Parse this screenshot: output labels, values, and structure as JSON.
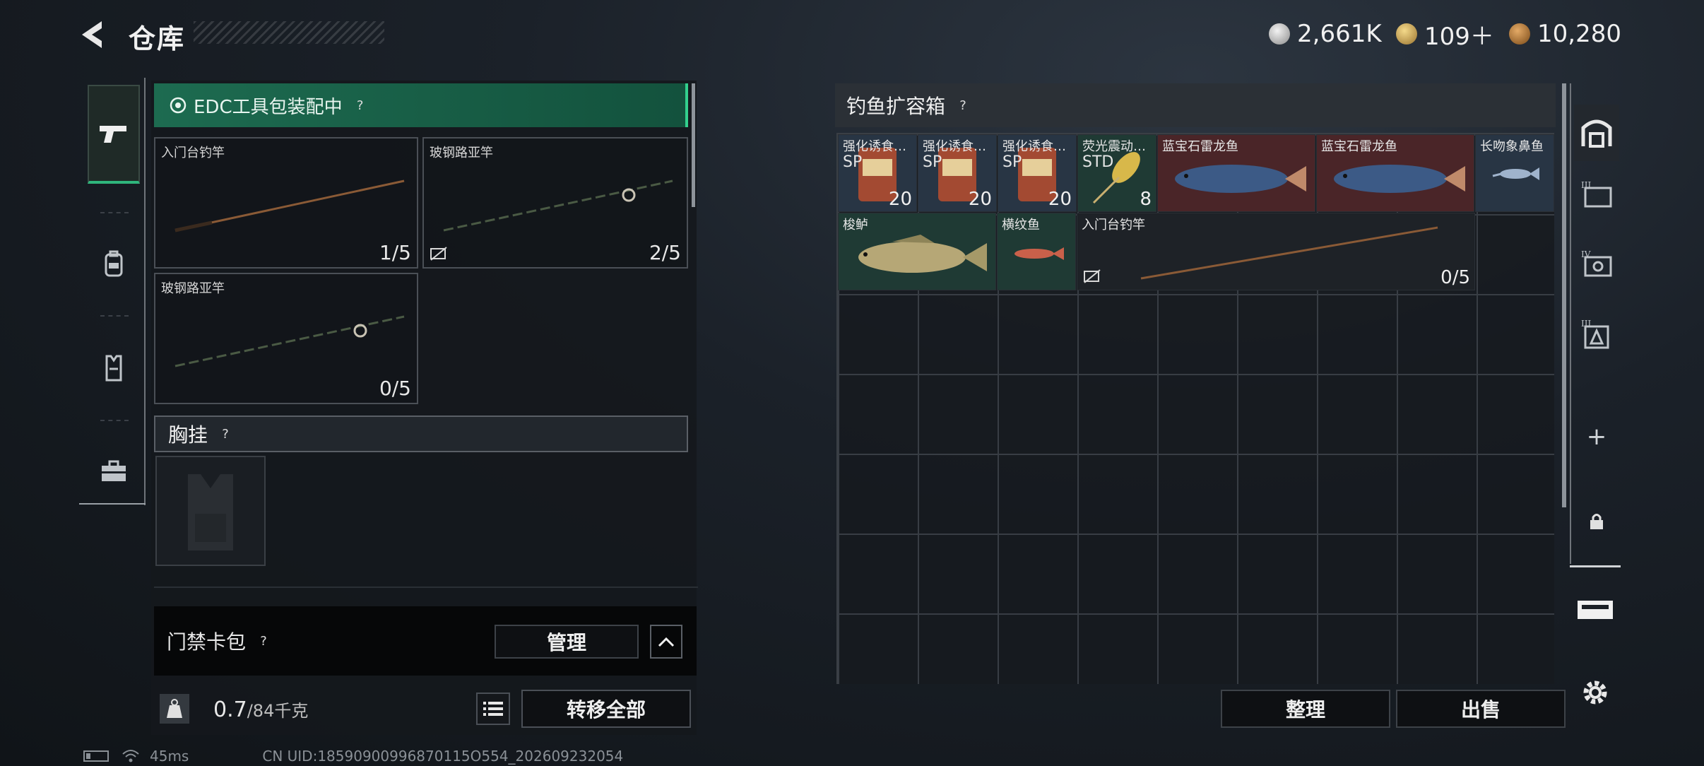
{
  "header": {
    "title": "仓库",
    "currencies": [
      {
        "icon": "silver-coin-icon",
        "value": "2,661K",
        "color": "#c9c9c9"
      },
      {
        "icon": "triangle-coin-icon",
        "value": "109＋",
        "color": "#c8a458"
      },
      {
        "icon": "bronze-coin-icon",
        "value": "10,280",
        "color": "#b07a3a"
      }
    ]
  },
  "left_nav": [
    {
      "icon": "pistol-icon",
      "active": true
    },
    {
      "icon": "backpack-icon"
    },
    {
      "icon": "vest-icon"
    },
    {
      "icon": "toolbox-icon"
    }
  ],
  "loadout": {
    "edc_banner": "EDC工具包装配中",
    "help": "?",
    "rods": [
      {
        "label": "入门台钓竿",
        "count": "1/5",
        "locked": false
      },
      {
        "label": "玻钢路亚竿",
        "count": "2/5",
        "locked": true
      },
      {
        "label": "玻钢路亚竿",
        "count": "0/5",
        "locked": false
      }
    ],
    "chest_rig": {
      "label": "胸挂",
      "help": "?"
    },
    "card_pack": {
      "label": "门禁卡包",
      "help": "?",
      "manage": "管理"
    },
    "weight": {
      "value": "0.7",
      "capacity": "/84千克",
      "icon_text": "KG"
    },
    "transfer_all": "转移全部"
  },
  "storage": {
    "title": "钓鱼扩容箱",
    "help": "?",
    "items": [
      {
        "name": "强化诱食…",
        "sub": "SP",
        "count": "20",
        "color": "#283544"
      },
      {
        "name": "强化诱食…",
        "sub": "SP",
        "count": "20",
        "color": "#283544"
      },
      {
        "name": "强化诱食…",
        "sub": "SP",
        "count": "20",
        "color": "#283544"
      },
      {
        "name": "荧光震动…",
        "sub": "STD",
        "count": "8",
        "color": "#1f3a34"
      },
      {
        "name": "蓝宝石雷龙鱼",
        "sub": "",
        "count": "",
        "color": "#4a2528"
      },
      {
        "name": "蓝宝石雷龙鱼",
        "sub": "",
        "count": "",
        "color": "#4a2528"
      },
      {
        "name": "长吻象鼻鱼",
        "sub": "",
        "count": "",
        "color": "#283544"
      },
      {
        "name": "梭鲈",
        "sub": "",
        "count": "",
        "color": "#1f3a34"
      },
      {
        "name": "横纹鱼",
        "sub": "",
        "count": "",
        "color": "#1f3a34"
      },
      {
        "name": "入门台钓竿",
        "sub": "",
        "count": "0/5",
        "color": "#1e2227"
      }
    ],
    "sort": "整理",
    "sell": "出售"
  },
  "right_nav": [
    {
      "icon": "storage-icon",
      "text": ""
    },
    {
      "icon": "tier-3-box-icon",
      "text": "III"
    },
    {
      "icon": "tier-4-box-icon",
      "text": "IV"
    },
    {
      "icon": "tier-3-bag-icon",
      "text": "III"
    },
    {
      "icon": "plus-icon",
      "text": "+"
    },
    {
      "icon": "lock-icon",
      "text": ""
    },
    {
      "icon": "case-icon",
      "text": ""
    },
    {
      "icon": "gear-icon",
      "text": ""
    }
  ],
  "status_bar": {
    "ping": "45ms",
    "uid": "CN UID:18590900996870115O554_202609232054"
  }
}
